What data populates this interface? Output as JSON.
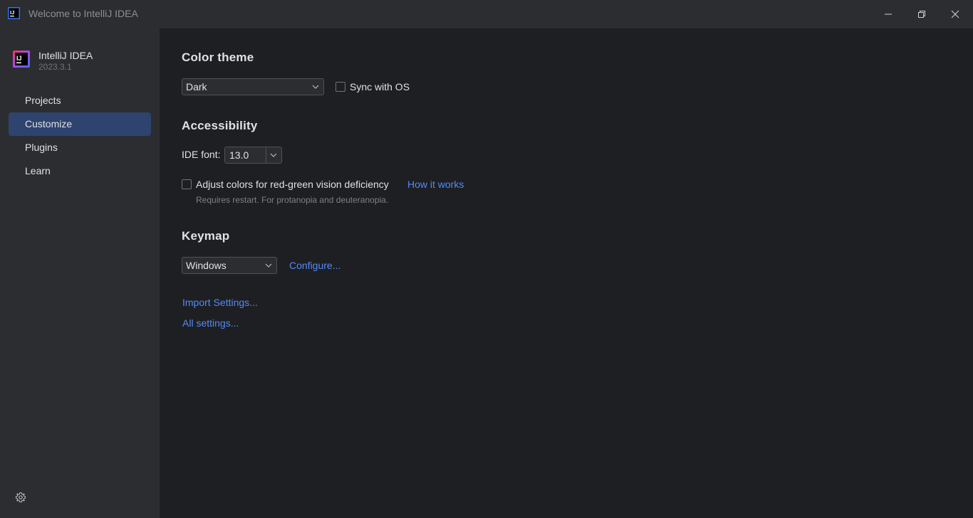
{
  "window": {
    "title": "Welcome to IntelliJ IDEA"
  },
  "app": {
    "name": "IntelliJ IDEA",
    "version": "2023.3.1",
    "logo_text": "IJ"
  },
  "sidebar": {
    "items": [
      {
        "label": "Projects",
        "selected": false
      },
      {
        "label": "Customize",
        "selected": true
      },
      {
        "label": "Plugins",
        "selected": false
      },
      {
        "label": "Learn",
        "selected": false
      }
    ]
  },
  "color_theme": {
    "title": "Color theme",
    "selected": "Dark",
    "sync_label": "Sync with OS",
    "sync_checked": false
  },
  "accessibility": {
    "title": "Accessibility",
    "font_label": "IDE font:",
    "font_value": "13.0",
    "adjust_label": "Adjust colors for red-green vision deficiency",
    "adjust_checked": false,
    "how_it_works": "How it works",
    "hint": "Requires restart. For protanopia and deuteranopia."
  },
  "keymap": {
    "title": "Keymap",
    "selected": "Windows",
    "configure": "Configure..."
  },
  "links": {
    "import_settings": "Import Settings...",
    "all_settings": "All settings..."
  },
  "colors": {
    "accent": "#548af7",
    "selection": "#2e436e",
    "sidebar_bg": "#2b2d30",
    "main_bg": "#1e1f22"
  }
}
